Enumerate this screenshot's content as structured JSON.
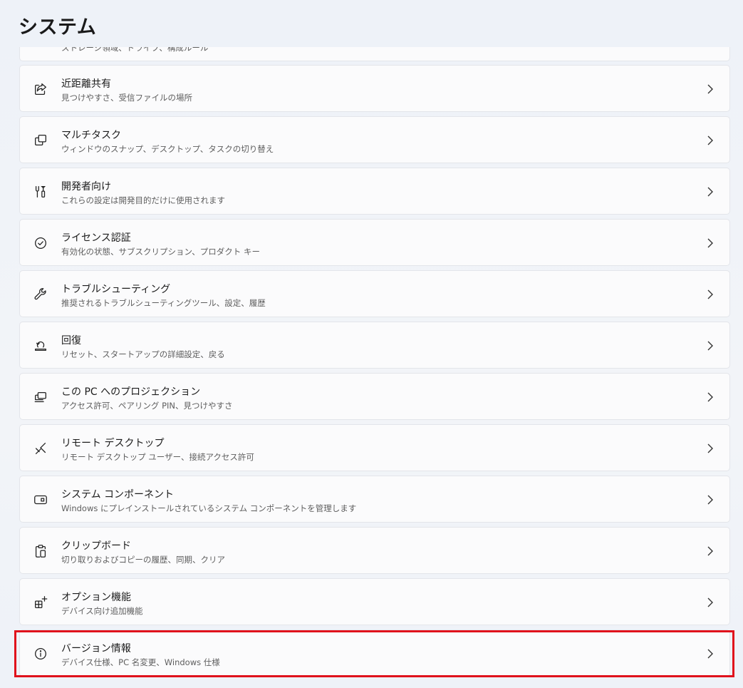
{
  "page": {
    "title": "システム"
  },
  "partial_item": {
    "desc": "ストレージ領域、ドライブ、構成ルール"
  },
  "items": [
    {
      "name": "近距離共有",
      "desc": "見つけやすさ、受信ファイルの場所",
      "icon": "share-icon"
    },
    {
      "name": "マルチタスク",
      "desc": "ウィンドウのスナップ、デスクトップ、タスクの切り替え",
      "icon": "multitask-icon"
    },
    {
      "name": "開発者向け",
      "desc": "これらの設定は開発目的だけに使用されます",
      "icon": "developer-tools-icon"
    },
    {
      "name": "ライセンス認証",
      "desc": "有効化の状態、サブスクリプション、プロダクト キー",
      "icon": "check-circle-icon"
    },
    {
      "name": "トラブルシューティング",
      "desc": "推奨されるトラブルシューティングツール、設定、履歴",
      "icon": "wrench-icon"
    },
    {
      "name": "回復",
      "desc": "リセット、スタートアップの詳細設定、戻る",
      "icon": "recovery-icon"
    },
    {
      "name": "この PC へのプロジェクション",
      "desc": "アクセス許可、ペアリング PIN、見つけやすさ",
      "icon": "projection-icon"
    },
    {
      "name": "リモート デスクトップ",
      "desc": "リモート デスクトップ ユーザー、接続アクセス許可",
      "icon": "remote-desktop-icon"
    },
    {
      "name": "システム コンポーネント",
      "desc": "Windows にプレインストールされているシステム コンポーネントを管理します",
      "icon": "system-components-icon"
    },
    {
      "name": "クリップボード",
      "desc": "切り取りおよびコピーの履歴、同期、クリア",
      "icon": "clipboard-icon"
    },
    {
      "name": "オプション機能",
      "desc": "デバイス向け追加機能",
      "icon": "optional-features-icon"
    },
    {
      "name": "バージョン情報",
      "desc": "デバイス仕様、PC 名変更、Windows 仕様",
      "icon": "info-icon"
    }
  ],
  "colors": {
    "highlight": "#e0121c",
    "card_bg": "#fbfbfc",
    "page_bg": "#eef2f8"
  }
}
